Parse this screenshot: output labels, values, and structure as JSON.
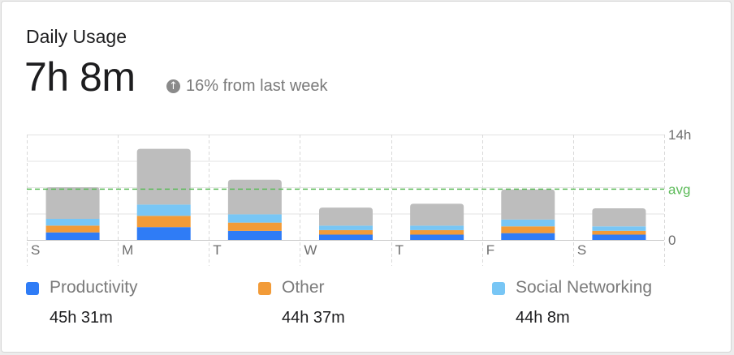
{
  "header": {
    "title": "Daily Usage",
    "total": "7h 8m",
    "trend_icon": "arrow-up-circle-icon",
    "trend_text": "16% from last week"
  },
  "colors": {
    "productivity": "#2f7cf6",
    "other": "#f29b38",
    "social": "#78c6f5",
    "remaining": "#bdbdbd",
    "avg": "#5dbb5a"
  },
  "chart_data": {
    "type": "bar",
    "stacked": true,
    "categories": [
      "S",
      "M",
      "T",
      "W",
      "T",
      "F",
      "S"
    ],
    "y_tick_labels": [
      "14h",
      "avg",
      "0"
    ],
    "ylim": [
      0,
      14
    ],
    "avg": 6.8,
    "grid": true,
    "series": [
      {
        "name": "Productivity",
        "color": "#2f7cf6",
        "values": [
          1.0,
          1.7,
          1.2,
          0.7,
          0.7,
          0.9,
          0.7
        ]
      },
      {
        "name": "Other",
        "color": "#f29b38",
        "values": [
          0.9,
          1.5,
          1.1,
          0.6,
          0.6,
          0.9,
          0.5
        ]
      },
      {
        "name": "Social Networking",
        "color": "#78c6f5",
        "values": [
          0.9,
          1.5,
          1.1,
          0.6,
          0.6,
          0.9,
          0.6
        ]
      },
      {
        "color": "#bdbdbd",
        "values": [
          4.2,
          7.4,
          4.6,
          2.4,
          2.9,
          4.0,
          2.4
        ]
      }
    ]
  },
  "legend": [
    {
      "name": "Productivity",
      "value": "45h 31m",
      "color": "#2f7cf6"
    },
    {
      "name": "Other",
      "value": "44h 37m",
      "color": "#f29b38"
    },
    {
      "name": "Social Networking",
      "value": "44h 8m",
      "color": "#78c6f5"
    }
  ]
}
